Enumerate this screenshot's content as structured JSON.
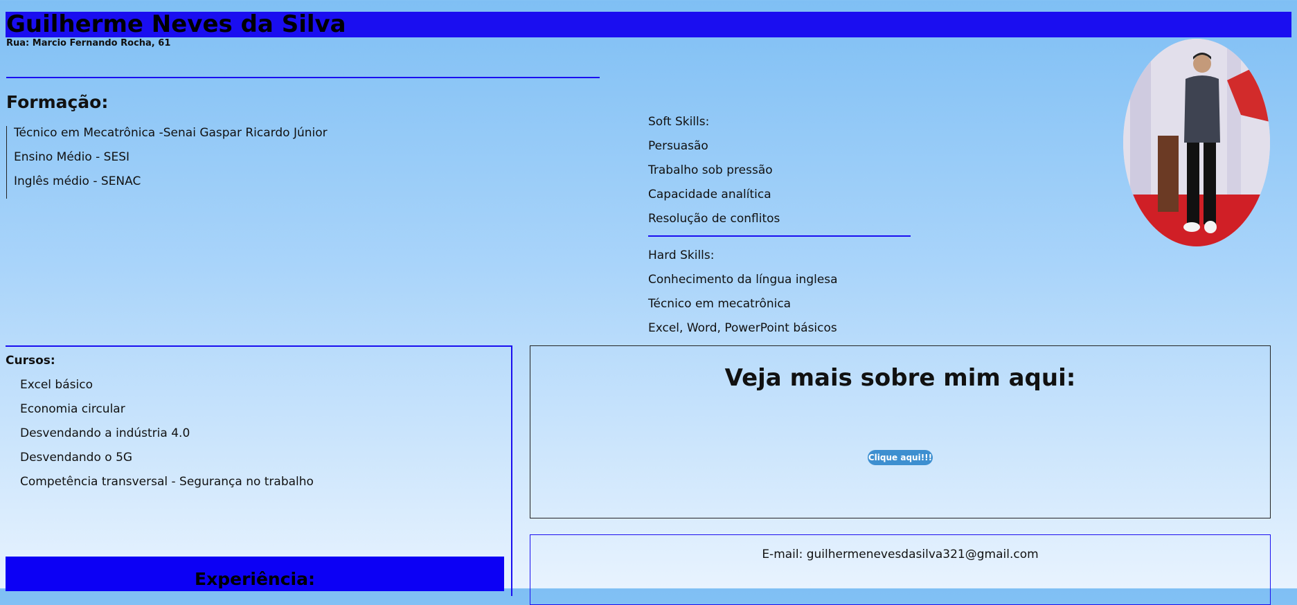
{
  "header": {
    "name": "Guilherme Neves da Silva",
    "address": "Rua: Marcio Fernando Rocha, 61"
  },
  "formacao": {
    "title": "Formação:",
    "items": [
      "Técnico em Mecatrônica -Senai Gaspar Ricardo Júnior",
      "Ensino Médio - SESI",
      "Inglês médio - SENAC"
    ]
  },
  "skills": {
    "soft_title": "Soft Skills:",
    "soft": [
      "Persuasão",
      "Trabalho sob pressão",
      "Capacidade analítica",
      "Resolução de conflitos"
    ],
    "hard_title": "Hard Skills:",
    "hard": [
      "Conhecimento da língua inglesa",
      "Técnico em mecatrônica",
      "Excel, Word, PowerPoint básicos"
    ]
  },
  "cursos": {
    "title": "Cursos:",
    "items": [
      "Excel básico",
      "Economia circular",
      "Desvendando a indústria 4.0",
      "Desvendando o 5G",
      "Competência transversal - Segurança no trabalho"
    ]
  },
  "experiencia": {
    "title": "Experiência:"
  },
  "link_section": {
    "title": "Veja mais sobre mim aqui:",
    "button_label": "Clique aqui!!!"
  },
  "contact": {
    "email": "E-mail: guilhermenevesdasilva321@gmail.com"
  },
  "colors": {
    "header_bar": "#1a0ef0",
    "button": "#3d8fd0",
    "experience_bar": "#0c00f5"
  }
}
